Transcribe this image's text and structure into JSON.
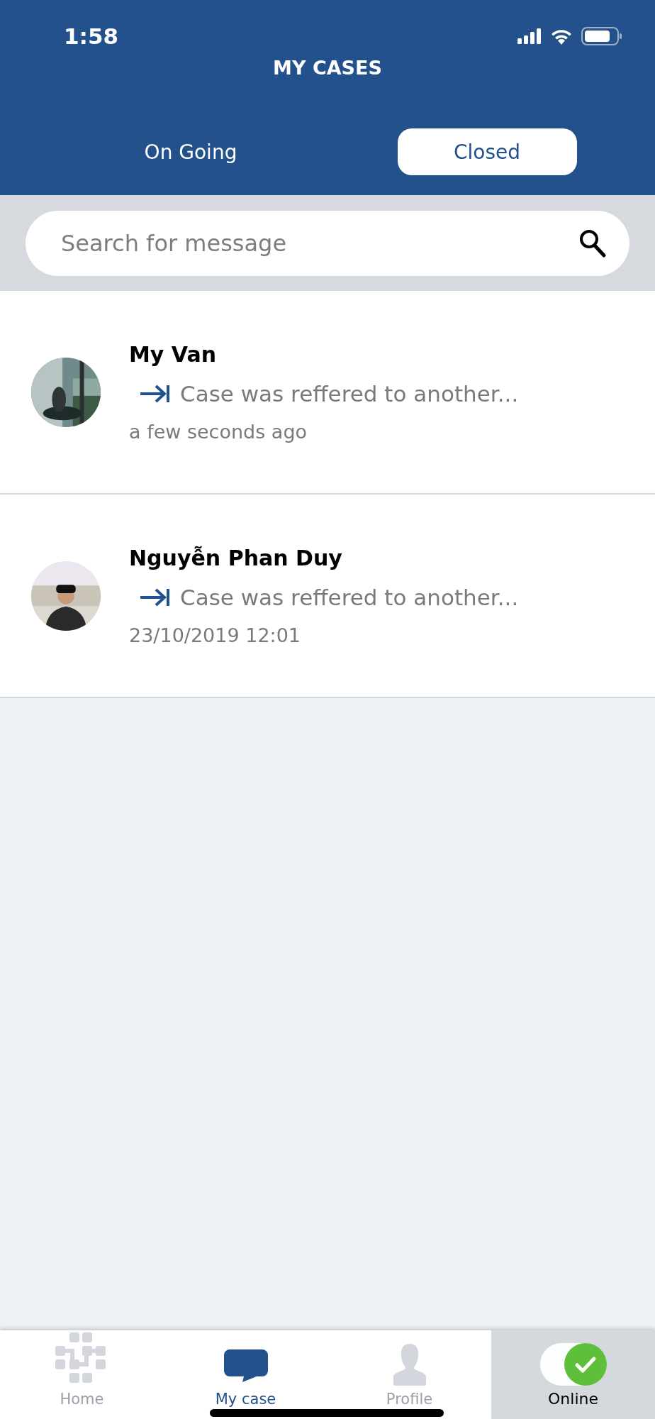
{
  "status_bar": {
    "time": "1:58"
  },
  "header": {
    "title": "MY CASES"
  },
  "tabs": [
    {
      "label": "On Going",
      "selected": false
    },
    {
      "label": "Closed",
      "selected": true
    }
  ],
  "search": {
    "placeholder": "Search for message"
  },
  "cases": [
    {
      "name": "My Van",
      "message": "Case was reffered to another...",
      "time": "a few seconds ago"
    },
    {
      "name": "Nguyễn Phan Duy",
      "message": "Case was reffered to another...",
      "time": "23/10/2019 12:01"
    }
  ],
  "bottom_nav": [
    {
      "label": "Home",
      "selected": false
    },
    {
      "label": "My case",
      "selected": true
    },
    {
      "label": "Profile",
      "selected": false
    }
  ],
  "online": {
    "label": "Online",
    "on": true
  }
}
